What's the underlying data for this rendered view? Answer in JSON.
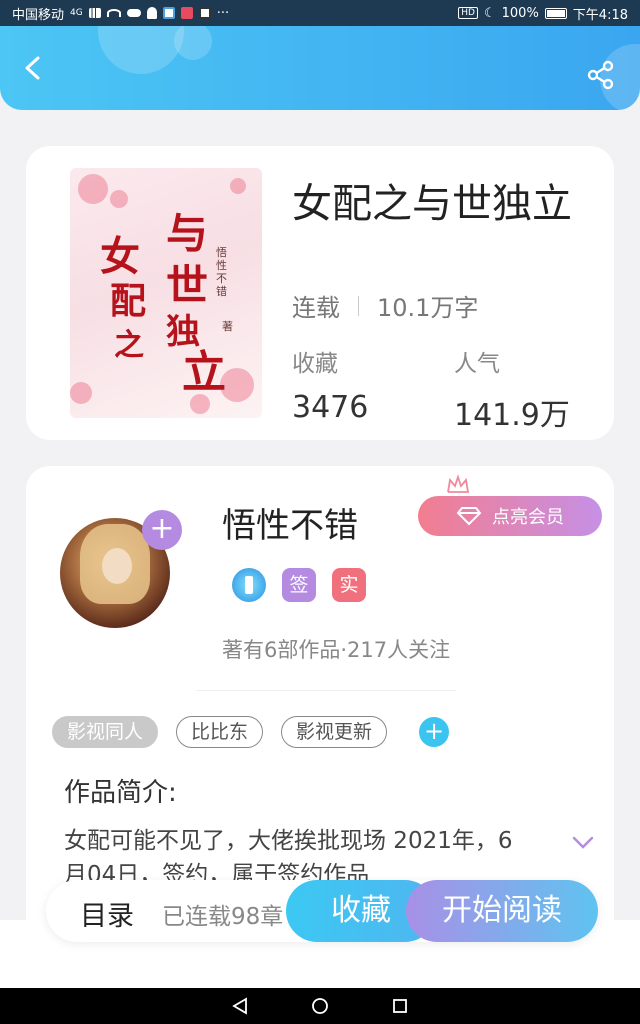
{
  "status_bar": {
    "carrier": "中国移动",
    "network": "4G",
    "battery": "100%",
    "time": "下午4:18",
    "hd": "HD"
  },
  "header": {
    "back_icon": "chevron-left-icon",
    "share_icon": "share-icon"
  },
  "book": {
    "cover_title_chars": [
      "女",
      "配",
      "之",
      "与",
      "世",
      "独",
      "立"
    ],
    "cover_author": "悟性不错",
    "cover_author_suffix": "著",
    "title": "女配之与世独立",
    "status": "连载",
    "word_count": "10.1万字",
    "fav_label": "收藏",
    "fav_value": "3476",
    "pop_label": "人气",
    "pop_value": "141.9万"
  },
  "author": {
    "name": "悟性不错",
    "vip_button": "点亮会员",
    "badges": [
      "签",
      "实"
    ],
    "stats": "著有6部作品·217人关注"
  },
  "tags": [
    "影视同人",
    "比比东",
    "影视更新"
  ],
  "intro": {
    "title": "作品简介:",
    "text": "女配可能不见了，大佬挨批现场 2021年，6月04日，签约，属于签约作品"
  },
  "bottom_bar": {
    "toc": "目录",
    "chapter_count": "已连载98章",
    "fav_button": "收藏",
    "read_button": "开始阅读"
  },
  "colors": {
    "header_start": "#4cc6f4",
    "header_end": "#3aa6f0",
    "vip_start": "#f27d8f",
    "vip_end": "#c690e6",
    "accent_purple": "#b48be0",
    "accent_cyan": "#3cc4f0"
  }
}
